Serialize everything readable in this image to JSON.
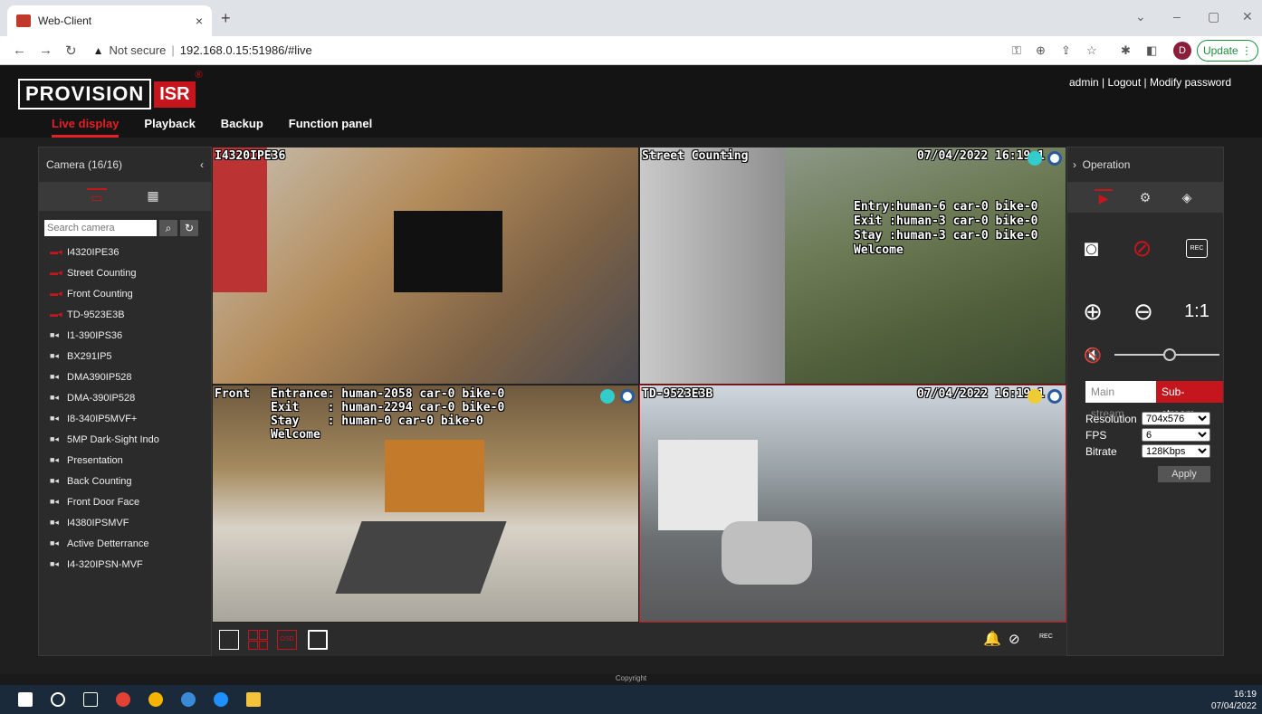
{
  "browser": {
    "tab_title": "Web-Client",
    "tab_close": "×",
    "new_tab": "+",
    "not_secure": "Not secure",
    "url": "192.168.0.15:51986/#live",
    "avatar_letter": "D",
    "update_label": "Update"
  },
  "header": {
    "logo_provision": "PROVISION",
    "logo_isr": "ISR",
    "logo_reg": "®",
    "user_links": "admin | Logout  |  Modify password",
    "nav": [
      "Live display",
      "Playback",
      "Backup",
      "Function panel"
    ]
  },
  "left_panel": {
    "title": "Camera (16/16)",
    "search_placeholder": "Search camera",
    "cameras": [
      {
        "name": "I4320IPE36",
        "live": true
      },
      {
        "name": "Street Counting",
        "live": true
      },
      {
        "name": "Front Counting",
        "live": true
      },
      {
        "name": "TD-9523E3B",
        "live": true
      },
      {
        "name": "I1-390IPS36",
        "live": false
      },
      {
        "name": "BX291IP5",
        "live": false
      },
      {
        "name": "DMA390IP528",
        "live": false
      },
      {
        "name": "DMA-390IP528",
        "live": false
      },
      {
        "name": "I8-340IP5MVF+",
        "live": false
      },
      {
        "name": "5MP Dark-Sight Indo",
        "live": false
      },
      {
        "name": "Presentation",
        "live": false
      },
      {
        "name": "Back Counting",
        "live": false
      },
      {
        "name": "Front Door Face",
        "live": false
      },
      {
        "name": "I4380IPSMVF",
        "live": false
      },
      {
        "name": "Active Detterrance",
        "live": false
      },
      {
        "name": "I4-320IPSN-MVF",
        "live": false
      }
    ]
  },
  "tiles": {
    "t1_name": "I4320IPE36",
    "t2_name": "Street Counting",
    "t2_time": "07/04/2022 16:19:1",
    "t2_stats": "Entry:human-6 car-0 bike-0\nExit :human-3 car-0 bike-0\nStay :human-3 car-0 bike-0\nWelcome",
    "t3_name": "Front",
    "t3_stats": "Entrance: human-2058 car-0 bike-0\nExit    : human-2294 car-0 bike-0\nStay    : human-0 car-0 bike-0\nWelcome",
    "t4_name": "TD-9523E3B",
    "t4_time": "07/04/2022 16:19:1"
  },
  "right_panel": {
    "title": "Operation",
    "main_stream": "Main stream",
    "sub_stream": "Sub-stream",
    "resolution_label": "Resolution",
    "resolution_value": "704x576",
    "fps_label": "FPS",
    "fps_value": "6",
    "bitrate_label": "Bitrate",
    "bitrate_value": "128Kbps",
    "apply_label": "Apply",
    "ratio_label": "1:1",
    "rec_label": "REC"
  },
  "gridbar": {
    "osd_label": "OSD",
    "rec_label": "REC"
  },
  "footer": {
    "copyright": "Copyright",
    "time": "16:19",
    "date": "07/04/2022"
  },
  "colors": {
    "accent": "#c4161c",
    "header_bg": "#141414",
    "panel_bg": "#2b2b2b"
  }
}
